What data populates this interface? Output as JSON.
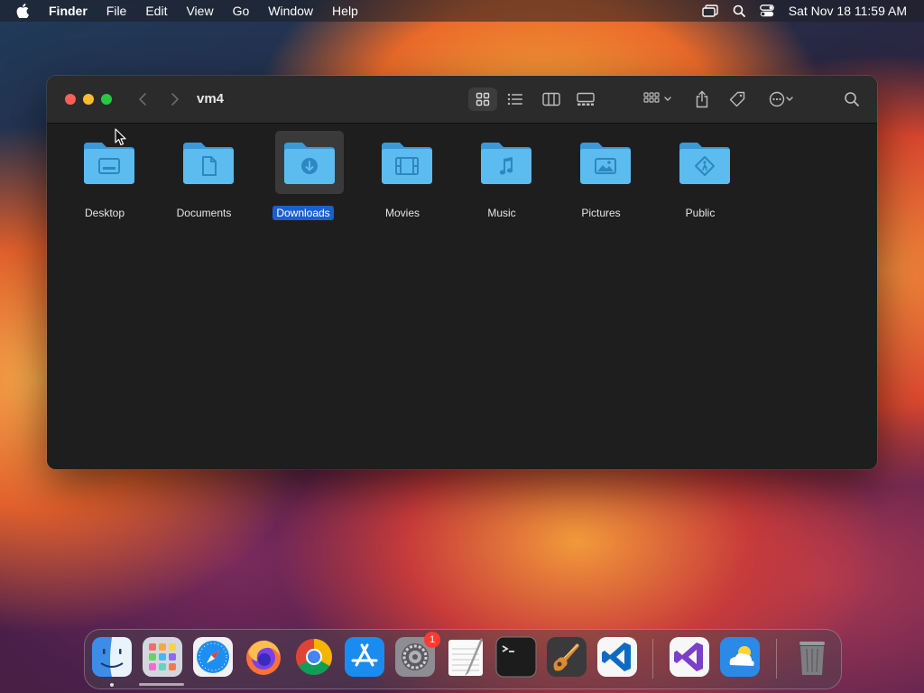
{
  "menubar": {
    "app_name": "Finder",
    "menus": [
      "File",
      "Edit",
      "View",
      "Go",
      "Window",
      "Help"
    ],
    "clock": "Sat Nov 18  11:59 AM"
  },
  "window": {
    "title": "vm4",
    "view_mode": "icon",
    "items": [
      {
        "label": "Desktop",
        "icon": "desktop-folder-icon"
      },
      {
        "label": "Documents",
        "icon": "documents-folder-icon"
      },
      {
        "label": "Downloads",
        "icon": "downloads-folder-icon",
        "selected": true
      },
      {
        "label": "Movies",
        "icon": "movies-folder-icon"
      },
      {
        "label": "Music",
        "icon": "music-folder-icon"
      },
      {
        "label": "Pictures",
        "icon": "pictures-folder-icon"
      },
      {
        "label": "Public",
        "icon": "public-folder-icon"
      }
    ]
  },
  "dock": {
    "apps": [
      "Finder",
      "Launchpad",
      "Safari",
      "Firefox",
      "Chrome",
      "App Store",
      "System Settings",
      "TextEdit",
      "Terminal",
      "GarageBand",
      "Visual Studio Code",
      "Visual Studio",
      "Weather",
      "Trash"
    ],
    "system_settings_badge": "1"
  },
  "colors": {
    "folder_blue": "#4fb6ee",
    "selection_blue": "#1a5fd0"
  }
}
